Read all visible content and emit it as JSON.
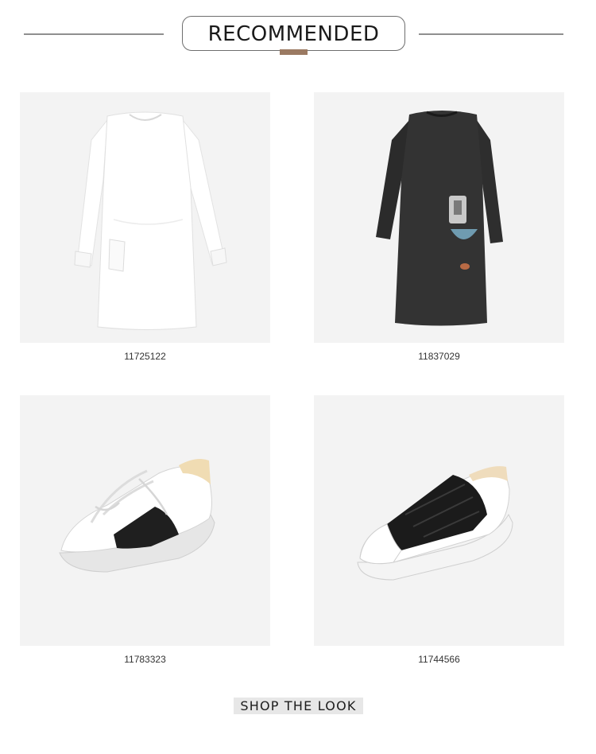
{
  "header": {
    "title": "RECOMMENDED"
  },
  "products": [
    {
      "sku": "11725122",
      "image": "white-sweatshirt-dress"
    },
    {
      "sku": "11837029",
      "image": "black-printed-dress"
    },
    {
      "sku": "11783323",
      "image": "white-lace-up-sneaker"
    },
    {
      "sku": "11744566",
      "image": "white-slip-on-platform-sneaker"
    }
  ],
  "cta": {
    "label": "SHOP THE LOOK"
  },
  "colors": {
    "accent": "#9b7a62",
    "card_bg": "#f3f3f3",
    "divider": "#8f8f8f",
    "cta_bg": "#e7e7e7"
  }
}
